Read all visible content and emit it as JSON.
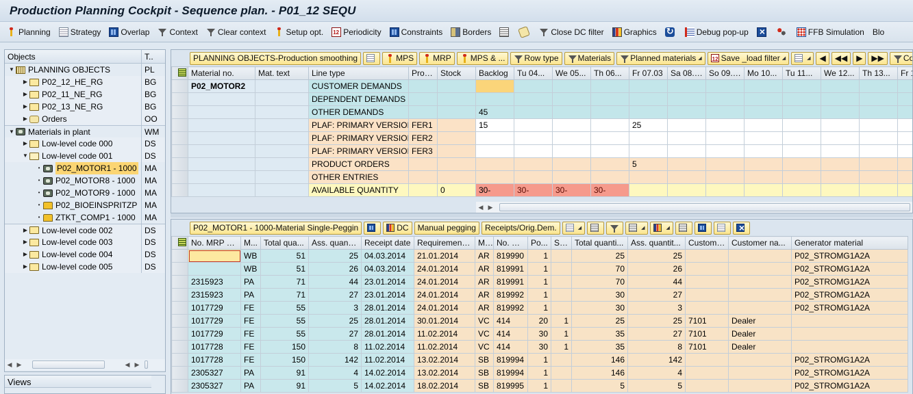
{
  "title": "Production Planning Cockpit - Sequence plan. - P01_12 SEQU",
  "toolbar": [
    {
      "label": "Planning",
      "icon": "pin-icon"
    },
    {
      "label": "Strategy",
      "icon": "strategy-icon"
    },
    {
      "label": "Overlap",
      "icon": "grid-icon"
    },
    {
      "label": "Context",
      "icon": "funnel-icon"
    },
    {
      "label": "Clear context",
      "icon": "clear-funnel-icon"
    },
    {
      "label": "Setup opt.",
      "icon": "pin-icon"
    },
    {
      "label": "Periodicity",
      "icon": "calendar-icon"
    },
    {
      "label": "Constraints",
      "icon": "grid-icon"
    },
    {
      "label": "Borders",
      "icon": "borders-icon"
    },
    {
      "label": "",
      "icon": "list-icon"
    },
    {
      "label": "",
      "icon": "scroll-icon"
    },
    {
      "label": "Close DC filter",
      "icon": "clear-funnel-icon"
    },
    {
      "label": "Graphics",
      "icon": "bar-chart-icon"
    },
    {
      "label": "",
      "icon": "refresh-icon"
    },
    {
      "label": "Debug pop-up",
      "icon": "debug-icon"
    },
    {
      "label": "",
      "icon": "close-icon"
    },
    {
      "label": "",
      "icon": "people-icon"
    },
    {
      "label": "FFB Simulation",
      "icon": "ffb-icon"
    },
    {
      "label": "Blo",
      "icon": ""
    }
  ],
  "tree": {
    "header": {
      "objects": "Objects",
      "type": "T.."
    },
    "rows": [
      {
        "label": "PLANNING OBJECTS",
        "type": "PL",
        "level": 0,
        "toggle": "expanded",
        "icon": "factory",
        "band": false
      },
      {
        "label": "P02_12_HE_RG",
        "type": "BG",
        "level": 1,
        "toggle": "collapsed",
        "icon": "folder",
        "band": true
      },
      {
        "label": "P02_11_NE_RG",
        "type": "BG",
        "level": 1,
        "toggle": "collapsed",
        "icon": "folder",
        "band": true
      },
      {
        "label": "P02_13_NE_RG",
        "type": "BG",
        "level": 1,
        "toggle": "collapsed",
        "icon": "folder",
        "band": true
      },
      {
        "label": "Orders",
        "type": "OO",
        "level": 1,
        "toggle": "collapsed",
        "icon": "orders",
        "band": true
      },
      {
        "label": "Materials in plant",
        "type": "WM",
        "level": 0,
        "toggle": "expanded",
        "icon": "material",
        "band": false
      },
      {
        "label": "Low-level code 000",
        "type": "DS",
        "level": 1,
        "toggle": "collapsed",
        "icon": "folder",
        "band": true
      },
      {
        "label": "Low-level code 001",
        "type": "DS",
        "level": 1,
        "toggle": "expanded",
        "icon": "folder-open",
        "band": true
      },
      {
        "label": "P02_MOTOR1 - 1000",
        "type": "MA",
        "level": 2,
        "toggle": "leaf",
        "icon": "material",
        "band": false,
        "selected": true
      },
      {
        "label": "P02_MOTOR8 - 1000",
        "type": "MA",
        "level": 2,
        "toggle": "leaf",
        "icon": "material",
        "band": false
      },
      {
        "label": "P02_MOTOR9 - 1000",
        "type": "MA",
        "level": 2,
        "toggle": "leaf",
        "icon": "material",
        "band": false
      },
      {
        "label": "P02_BIOEINSPRITZP",
        "type": "MA",
        "level": 2,
        "toggle": "leaf",
        "icon": "puzzle",
        "band": false
      },
      {
        "label": "ZTKT_COMP1 - 1000",
        "type": "MA",
        "level": 2,
        "toggle": "leaf",
        "icon": "puzzle",
        "band": false
      },
      {
        "label": "Low-level code 002",
        "type": "DS",
        "level": 1,
        "toggle": "collapsed",
        "icon": "folder",
        "band": true
      },
      {
        "label": "Low-level code 003",
        "type": "DS",
        "level": 1,
        "toggle": "collapsed",
        "icon": "folder",
        "band": true
      },
      {
        "label": "Low-level code 004",
        "type": "DS",
        "level": 1,
        "toggle": "collapsed",
        "icon": "folder",
        "band": true
      },
      {
        "label": "Low-level code 005",
        "type": "DS",
        "level": 1,
        "toggle": "collapsed",
        "icon": "folder",
        "band": true
      }
    ]
  },
  "views": {
    "label": "Views"
  },
  "upper": {
    "toolbar": [
      {
        "label": "PLANNING OBJECTS-Production smoothing",
        "icon": ""
      },
      {
        "label": "",
        "icon": "hierarchy-icon"
      },
      {
        "label": "MPS",
        "icon": "pin-icon"
      },
      {
        "label": "MRP",
        "icon": "pin-icon"
      },
      {
        "label": "MPS & ...",
        "icon": "pin-icon"
      },
      {
        "label": "Row type",
        "icon": "funnel-icon"
      },
      {
        "label": "Materials",
        "icon": "funnel-icon"
      },
      {
        "label": "Planned materials",
        "icon": "funnel-icon",
        "dropdown": true
      },
      {
        "label": "Save _load filter",
        "icon": "save-icon",
        "dropdown": true
      },
      {
        "label": "",
        "icon": "layout-icon",
        "dropdown": true
      },
      {
        "label": "◀",
        "icon": ""
      },
      {
        "label": "◀◀",
        "icon": ""
      },
      {
        "label": "▶",
        "icon": ""
      },
      {
        "label": "▶▶",
        "icon": ""
      },
      {
        "label": "Cont",
        "icon": "funnel-icon"
      }
    ],
    "columns": [
      "Material no.",
      "Mat. text",
      "Line type",
      "ProdV",
      "Stock",
      "Backlog",
      "Tu 04...",
      "We 05...",
      "Th 06...",
      "Fr 07.03",
      "Sa 08.03",
      "So 09.03",
      "Mo 10...",
      "Tu 11...",
      "We 12...",
      "Th 13...",
      "Fr 1"
    ],
    "material": "P02_MOTOR2",
    "rows": [
      {
        "line_type": "CUSTOMER DEMANDS",
        "prodv": "",
        "stock": "",
        "backlog": "",
        "days": [
          "",
          "",
          "",
          "",
          "",
          "",
          "",
          "",
          "",
          "",
          ""
        ],
        "style": "cyan"
      },
      {
        "line_type": "DEPENDENT DEMANDS",
        "prodv": "",
        "stock": "",
        "backlog": "",
        "days": [
          "",
          "",
          "",
          "",
          "",
          "",
          "",
          "",
          "",
          "",
          ""
        ],
        "style": "cyan"
      },
      {
        "line_type": "OTHER DEMANDS",
        "prodv": "",
        "stock": "",
        "backlog": "45",
        "days": [
          "",
          "",
          "",
          "",
          "",
          "",
          "",
          "",
          "",
          "",
          ""
        ],
        "style": "cyan"
      },
      {
        "line_type": "PLAF: PRIMARY VERSION",
        "prodv": "FER1",
        "stock": "",
        "backlog": "15",
        "days": [
          "",
          "",
          "",
          "25",
          "",
          "",
          "",
          "",
          "",
          "",
          ""
        ],
        "style": "plaf"
      },
      {
        "line_type": "PLAF: PRIMARY VERSION",
        "prodv": "FER2",
        "stock": "",
        "backlog": "",
        "days": [
          "",
          "",
          "",
          "",
          "",
          "",
          "",
          "",
          "",
          "",
          ""
        ],
        "style": "plaf"
      },
      {
        "line_type": "PLAF: PRIMARY VERSION",
        "prodv": "FER3",
        "stock": "",
        "backlog": "",
        "days": [
          "",
          "",
          "",
          "",
          "",
          "",
          "",
          "",
          "",
          "",
          ""
        ],
        "style": "plaf"
      },
      {
        "line_type": "PRODUCT ORDERS",
        "prodv": "",
        "stock": "",
        "backlog": "",
        "days": [
          "",
          "",
          "",
          "5",
          "",
          "",
          "",
          "",
          "",
          "",
          ""
        ],
        "style": "peach"
      },
      {
        "line_type": "OTHER ENTRIES",
        "prodv": "",
        "stock": "",
        "backlog": "",
        "days": [
          "",
          "",
          "",
          "",
          "",
          "",
          "",
          "",
          "",
          "",
          ""
        ],
        "style": "peach"
      },
      {
        "line_type": "AVAILABLE QUANTITY",
        "prodv": "",
        "stock": "0",
        "backlog": "30-",
        "days": [
          "30-",
          "30-",
          "30-",
          "",
          "",
          "",
          "",
          "",
          "",
          "",
          ""
        ],
        "style": "avail"
      }
    ]
  },
  "lower": {
    "toolbar": [
      {
        "label": "P02_MOTOR1 - 1000-Material Single-Peggin",
        "icon": ""
      },
      {
        "label": "",
        "icon": "binoculars-icon"
      },
      {
        "label": "DC",
        "icon": "dc-icon"
      },
      {
        "label": "Manual pegging",
        "icon": ""
      },
      {
        "label": "Receipts/Orig.Dem.",
        "icon": ""
      },
      {
        "label": "",
        "icon": "layout-icon",
        "dropdown": true
      },
      {
        "label": "",
        "icon": "sort-icon"
      },
      {
        "label": "",
        "icon": "filter-icon"
      },
      {
        "label": "",
        "icon": "sum-icon",
        "dropdown": true
      },
      {
        "label": "",
        "icon": "subtotal-icon",
        "dropdown": true
      },
      {
        "label": "",
        "icon": "print-icon"
      },
      {
        "label": "",
        "icon": "expand-icon"
      },
      {
        "label": "",
        "icon": "export-icon"
      },
      {
        "label": "",
        "icon": "close-icon"
      }
    ],
    "columns": [
      "No. MRP el...",
      "M...",
      "Total qua...",
      "Ass. quanti...",
      "Receipt date",
      "Requirement ...",
      "M...",
      "No. M...",
      "Po...",
      "Sc...",
      "Total quanti...",
      "Ass. quantit...",
      "Custome...",
      "Customer na...",
      "Generator material"
    ],
    "rows": [
      [
        "",
        "WB",
        "51",
        "25",
        "04.03.2014",
        "21.01.2014",
        "AR",
        "819990",
        "1",
        "",
        "25",
        "25",
        "",
        "",
        "P02_STROMG1A2A"
      ],
      [
        "",
        "WB",
        "51",
        "26",
        "04.03.2014",
        "24.01.2014",
        "AR",
        "819991",
        "1",
        "",
        "70",
        "26",
        "",
        "",
        "P02_STROMG1A2A"
      ],
      [
        "2315923",
        "PA",
        "71",
        "44",
        "23.01.2014",
        "24.01.2014",
        "AR",
        "819991",
        "1",
        "",
        "70",
        "44",
        "",
        "",
        "P02_STROMG1A2A"
      ],
      [
        "2315923",
        "PA",
        "71",
        "27",
        "23.01.2014",
        "24.01.2014",
        "AR",
        "819992",
        "1",
        "",
        "30",
        "27",
        "",
        "",
        "P02_STROMG1A2A"
      ],
      [
        "1017729",
        "FE",
        "55",
        "3",
        "28.01.2014",
        "24.01.2014",
        "AR",
        "819992",
        "1",
        "",
        "30",
        "3",
        "",
        "",
        "P02_STROMG1A2A"
      ],
      [
        "1017729",
        "FE",
        "55",
        "25",
        "28.01.2014",
        "30.01.2014",
        "VC",
        "414",
        "20",
        "1",
        "25",
        "25",
        "7101",
        "Dealer",
        ""
      ],
      [
        "1017729",
        "FE",
        "55",
        "27",
        "28.01.2014",
        "11.02.2014",
        "VC",
        "414",
        "30",
        "1",
        "35",
        "27",
        "7101",
        "Dealer",
        ""
      ],
      [
        "1017728",
        "FE",
        "150",
        "8",
        "11.02.2014",
        "11.02.2014",
        "VC",
        "414",
        "30",
        "1",
        "35",
        "8",
        "7101",
        "Dealer",
        ""
      ],
      [
        "1017728",
        "FE",
        "150",
        "142",
        "11.02.2014",
        "13.02.2014",
        "SB",
        "819994",
        "1",
        "",
        "146",
        "142",
        "",
        "",
        "P02_STROMG1A2A"
      ],
      [
        "2305327",
        "PA",
        "91",
        "4",
        "14.02.2014",
        "13.02.2014",
        "SB",
        "819994",
        "1",
        "",
        "146",
        "4",
        "",
        "",
        "P02_STROMG1A2A"
      ],
      [
        "2305327",
        "PA",
        "91",
        "5",
        "14.02.2014",
        "18.02.2014",
        "SB",
        "819995",
        "1",
        "",
        "5",
        "5",
        "",
        "",
        "P02_STROMG1A2A"
      ]
    ]
  }
}
